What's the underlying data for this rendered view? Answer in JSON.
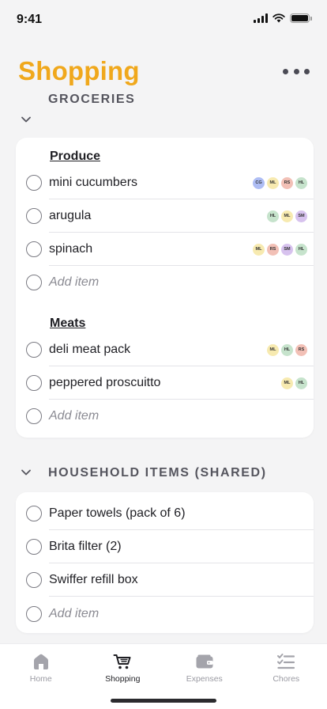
{
  "status": {
    "time": "9:41"
  },
  "header": {
    "title": "Shopping",
    "more_icon": "more-horizontal-icon"
  },
  "colors": {
    "accent": "#f0a81c",
    "text": "#1f1f24",
    "muted": "#8b8b93"
  },
  "sections": [
    {
      "title": "GROCERIES",
      "groups": [
        {
          "title": "Produce",
          "items": [
            {
              "label": "mini cucumbers",
              "badges": [
                {
                  "text": "CG",
                  "color": "#aebdf4"
                },
                {
                  "text": "ML",
                  "color": "#f7eab0"
                },
                {
                  "text": "RS",
                  "color": "#f2c0b6"
                },
                {
                  "text": "HL",
                  "color": "#c6e3cc"
                }
              ]
            },
            {
              "label": "arugula",
              "badges": [
                {
                  "text": "HL",
                  "color": "#c6e3cc"
                },
                {
                  "text": "ML",
                  "color": "#f7eab0"
                },
                {
                  "text": "SM",
                  "color": "#d7c2ee"
                }
              ]
            },
            {
              "label": "spinach",
              "badges": [
                {
                  "text": "ML",
                  "color": "#f7eab0"
                },
                {
                  "text": "RS",
                  "color": "#f2c0b6"
                },
                {
                  "text": "SM",
                  "color": "#d7c2ee"
                },
                {
                  "text": "HL",
                  "color": "#c6e3cc"
                }
              ]
            }
          ],
          "add_label": "Add item"
        },
        {
          "title": "Meats",
          "items": [
            {
              "label": "deli meat pack",
              "badges": [
                {
                  "text": "ML",
                  "color": "#f7eab0"
                },
                {
                  "text": "HL",
                  "color": "#c6e3cc"
                },
                {
                  "text": "RS",
                  "color": "#f2c0b6"
                }
              ]
            },
            {
              "label": "peppered proscuitto",
              "badges": [
                {
                  "text": "ML",
                  "color": "#f7eab0"
                },
                {
                  "text": "HL",
                  "color": "#c6e3cc"
                }
              ]
            }
          ],
          "add_label": "Add item"
        }
      ]
    },
    {
      "title": "HOUSEHOLD ITEMS (SHARED)",
      "items": [
        {
          "label": "Paper towels (pack of 6)"
        },
        {
          "label": "Brita filter (2)"
        },
        {
          "label": "Swiffer refill box"
        }
      ],
      "add_label": "Add item"
    }
  ],
  "tabs": [
    {
      "label": "Home",
      "icon": "home-icon",
      "active": false
    },
    {
      "label": "Shopping",
      "icon": "shopping-cart-icon",
      "active": true
    },
    {
      "label": "Expenses",
      "icon": "wallet-icon",
      "active": false
    },
    {
      "label": "Chores",
      "icon": "checklist-icon",
      "active": false
    }
  ]
}
